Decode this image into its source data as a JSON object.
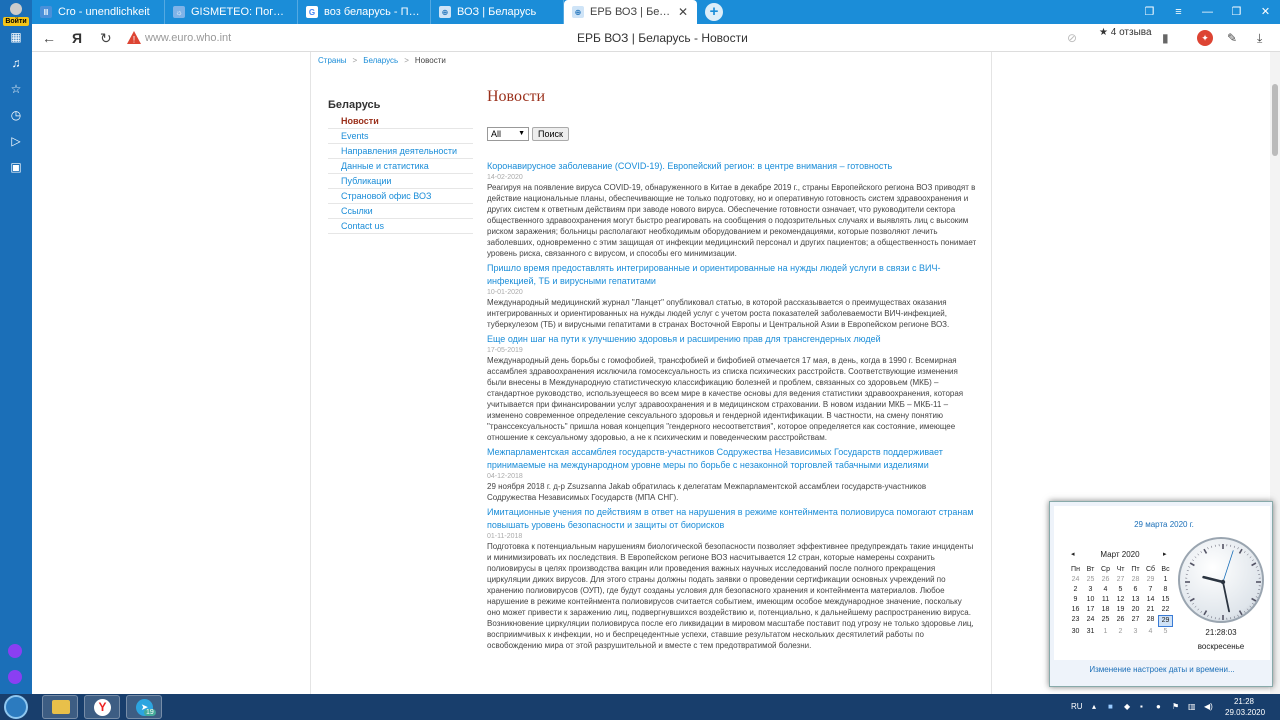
{
  "browser": {
    "login_label": "Войти",
    "tabs": [
      {
        "title": "Cro - unendlichkeit",
        "icon": "pause-icon"
      },
      {
        "title": "GISMETEO: Погода в Мин",
        "icon": "gismeteo-icon"
      },
      {
        "title": "воз беларусь - Поиск в G",
        "icon": "google-icon"
      },
      {
        "title": "ВОЗ | Беларусь",
        "icon": "who-icon"
      },
      {
        "title": "ЕРБ ВОЗ | Беларусь - Н",
        "icon": "who-icon"
      }
    ],
    "new_tab": "+",
    "address": "www.euro.who.int",
    "page_title": "ЕРБ ВОЗ | Беларусь - Новости",
    "reviews": "4 отзыва",
    "reviews_star": "★"
  },
  "breadcrumb": [
    "Страны",
    "Беларусь",
    "Новости"
  ],
  "left_nav": {
    "title": "Беларусь",
    "items": [
      "Новости",
      "Events",
      "Направления деятельности",
      "Данные и статистика",
      "Публикации",
      "Страновой офис ВОЗ",
      "Ссылки",
      "Contact us"
    ]
  },
  "news": {
    "heading": "Новости",
    "filter": {
      "selected": "All",
      "button": "Поиск"
    },
    "items": [
      {
        "title": "Коронавирусное заболевание (COVID-19). Европейский регион: в центре внимания – готовность",
        "date": "14-02-2020",
        "text": "Реагируя на появление вируса COVID-19, обнаруженного в Китае в декабре 2019 г., страны Европейского региона ВОЗ приводят в действие национальные планы, обеспечивающие не только подготовку, но и оперативную готовность систем здравоохранения и других систем к ответным действиям при заводе нового вируса. Обеспечение готовности означает, что руководители сектора общественного здравоохранения могут быстро реагировать на сообщения о подозрительных случаях и выявлять лиц с высоким риском заражения; больницы располагают необходимым оборудованием и рекомендациями, которые позволяют лечить заболевших, одновременно с этим защищая от инфекции медицинский персонал и других пациентов; а общественность понимает уровень риска, связанного с вирусом, и способы его минимизации."
      },
      {
        "title": "Пришло время предоставлять интегрированные и ориентированные на нужды людей услуги в связи с ВИЧ-инфекцией, ТБ и вирусными гепатитами",
        "date": "10-01-2020",
        "text": "Международный медицинский журнал \"Ланцет\" опубликовал статью, в которой рассказывается о преимуществах оказания интегрированных и ориентированных на нужды людей услуг с учетом роста показателей заболеваемости ВИЧ-инфекцией, туберкулезом (ТБ) и вирусными гепатитами в странах Восточной Европы и Центральной Азии в Европейском регионе ВОЗ."
      },
      {
        "title": "Еще один шаг на пути к улучшению здоровья и расширению прав для трансгендерных людей",
        "date": "17-05-2019",
        "text": "Международный день борьбы с гомофобией, трансфобией и бифобией отмечается 17 мая, в день, когда в 1990 г. Всемирная ассамблея здравоохранения исключила гомосексуальность из списка психических расстройств. Соответствующие изменения были внесены в Международную статистическую классификацию болезней и проблем, связанных со здоровьем (МКБ) – стандартное руководство, используещееся во всем мире в качестве основы для ведения статистики здравоохранения, которая учитывается при финансировании услуг здравоохранения и в медицинском страховании. В новом издании МКБ – МКБ-11 – изменено современное определение сексуального здоровья и гендерной идентификации. В частности, на смену понятию \"транссексуальность\" пришла новая концепция \"гендерного несоответствия\", которое определяется как состояние, имеющее отношение к сексуальному здоровью, а не к психическим и поведенческим расстройствам."
      },
      {
        "title": "Межпарламентская ассамблея государств-участников Содружества Независимых Государств поддерживает принимаемые на международном уровне меры по борьбе с незаконной торговлей табачными изделиями",
        "date": "04-12-2018",
        "text": "29 ноября 2018 г. д-р Zsuzsanna Jakab обратилась к делегатам Межпарламентской ассамблеи государств-участников Содружества Независимых Государств (МПА СНГ)."
      },
      {
        "title": "Имитационные учения по действиям в ответ на нарушения в режиме контейнмента полиовируса помогают странам повышать уровень безопасности и защиты от биорисков",
        "date": "01-11-2018",
        "text": "Подготовка к потенциальным нарушениям биологической безопасности позволяет эффективнее предупреждать такие инциденты и минимизировать их последствия. В Европейском регионе ВОЗ насчитывается 12 стран, которые намерены сохранить полиовирусы в целях производства вакцин или проведения важных научных исследований после полного прекращения циркуляции диких вирусов. Для этого страны должны подать заявки о проведении сертификации основных учреждений по хранению полиовирусов (ОУП), где будут созданы условия для безопасного хранения и контейнмента материалов. Любое нарушение в режиме контейнмента полиовирусов считается событием, имеющим особое международное значение, поскольку оно может привести к заражению лиц, подвергнувшихся воздействию и, потенциально, к дальнейшему распространению вируса. Возникновение циркуляции полиовируса после его ликвидации в мировом масштабе поставит под угрозу не только здоровье лиц, восприимчивых к инфекции, но и беспрецедентные успехи, ставшие результатом нескольких десятилетий работы по освобождению мира от этой разрушительной и вместе с тем предотвратимой болезни."
      }
    ]
  },
  "calendar_popup": {
    "date_header": "29 марта 2020 г.",
    "month": "Март 2020",
    "prev": "◂",
    "next": "▸",
    "weekdays": [
      "Пн",
      "Вт",
      "Ср",
      "Чт",
      "Пт",
      "Сб",
      "Вс"
    ],
    "weeks": [
      [
        "24",
        "25",
        "26",
        "27",
        "28",
        "29",
        "1"
      ],
      [
        "2",
        "3",
        "4",
        "5",
        "6",
        "7",
        "8"
      ],
      [
        "9",
        "10",
        "11",
        "12",
        "13",
        "14",
        "15"
      ],
      [
        "16",
        "17",
        "18",
        "19",
        "20",
        "21",
        "22"
      ],
      [
        "23",
        "24",
        "25",
        "26",
        "27",
        "28",
        "29"
      ],
      [
        "30",
        "31",
        "1",
        "2",
        "3",
        "4",
        "5"
      ]
    ],
    "today": "29",
    "time": "21:28:03",
    "clock": {
      "hours": 21,
      "minutes": 28,
      "seconds": 3
    },
    "weekday": "воскресенье",
    "settings_link": "Изменение настроек даты и времени..."
  },
  "taskbar": {
    "lang": "RU",
    "time": "21:28",
    "date": "29.03.2020",
    "badge": "19"
  }
}
